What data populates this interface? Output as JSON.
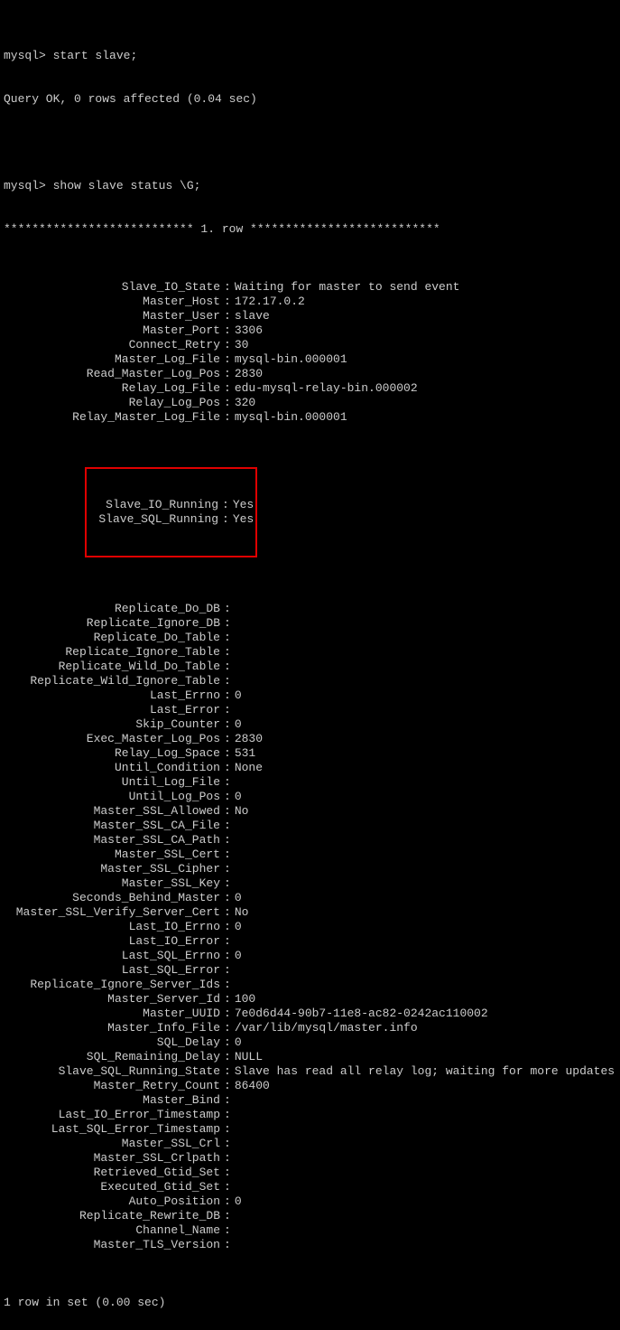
{
  "prompt": "mysql>",
  "cmd1": "start slave;",
  "result1": "Query OK, 0 rows affected (0.04 sec)",
  "cmd2": "show slave status \\G;",
  "row_header": "*************************** 1. row ***************************",
  "fields": [
    {
      "k": "Slave_IO_State",
      "v": "Waiting for master to send event"
    },
    {
      "k": "Master_Host",
      "v": "172.17.0.2"
    },
    {
      "k": "Master_User",
      "v": "slave"
    },
    {
      "k": "Master_Port",
      "v": "3306"
    },
    {
      "k": "Connect_Retry",
      "v": "30"
    },
    {
      "k": "Master_Log_File",
      "v": "mysql-bin.000001"
    },
    {
      "k": "Read_Master_Log_Pos",
      "v": "2830"
    },
    {
      "k": "Relay_Log_File",
      "v": "edu-mysql-relay-bin.000002"
    },
    {
      "k": "Relay_Log_Pos",
      "v": "320"
    },
    {
      "k": "Relay_Master_Log_File",
      "v": "mysql-bin.000001"
    }
  ],
  "highlighted": [
    {
      "k": "Slave_IO_Running",
      "v": "Yes"
    },
    {
      "k": "Slave_SQL_Running",
      "v": "Yes"
    }
  ],
  "fields2": [
    {
      "k": "Replicate_Do_DB",
      "v": ""
    },
    {
      "k": "Replicate_Ignore_DB",
      "v": ""
    },
    {
      "k": "Replicate_Do_Table",
      "v": ""
    },
    {
      "k": "Replicate_Ignore_Table",
      "v": ""
    },
    {
      "k": "Replicate_Wild_Do_Table",
      "v": ""
    },
    {
      "k": "Replicate_Wild_Ignore_Table",
      "v": ""
    },
    {
      "k": "Last_Errno",
      "v": "0"
    },
    {
      "k": "Last_Error",
      "v": ""
    },
    {
      "k": "Skip_Counter",
      "v": "0"
    },
    {
      "k": "Exec_Master_Log_Pos",
      "v": "2830"
    },
    {
      "k": "Relay_Log_Space",
      "v": "531"
    },
    {
      "k": "Until_Condition",
      "v": "None"
    },
    {
      "k": "Until_Log_File",
      "v": ""
    },
    {
      "k": "Until_Log_Pos",
      "v": "0"
    },
    {
      "k": "Master_SSL_Allowed",
      "v": "No"
    },
    {
      "k": "Master_SSL_CA_File",
      "v": ""
    },
    {
      "k": "Master_SSL_CA_Path",
      "v": ""
    },
    {
      "k": "Master_SSL_Cert",
      "v": ""
    },
    {
      "k": "Master_SSL_Cipher",
      "v": ""
    },
    {
      "k": "Master_SSL_Key",
      "v": ""
    },
    {
      "k": "Seconds_Behind_Master",
      "v": "0"
    },
    {
      "k": "Master_SSL_Verify_Server_Cert",
      "v": "No"
    },
    {
      "k": "Last_IO_Errno",
      "v": "0"
    },
    {
      "k": "Last_IO_Error",
      "v": ""
    },
    {
      "k": "Last_SQL_Errno",
      "v": "0"
    },
    {
      "k": "Last_SQL_Error",
      "v": ""
    },
    {
      "k": "Replicate_Ignore_Server_Ids",
      "v": ""
    },
    {
      "k": "Master_Server_Id",
      "v": "100"
    },
    {
      "k": "Master_UUID",
      "v": "7e0d6d44-90b7-11e8-ac82-0242ac110002"
    },
    {
      "k": "Master_Info_File",
      "v": "/var/lib/mysql/master.info"
    },
    {
      "k": "SQL_Delay",
      "v": "0"
    },
    {
      "k": "SQL_Remaining_Delay",
      "v": "NULL"
    },
    {
      "k": "Slave_SQL_Running_State",
      "v": "Slave has read all relay log; waiting for more updates"
    },
    {
      "k": "Master_Retry_Count",
      "v": "86400"
    },
    {
      "k": "Master_Bind",
      "v": ""
    },
    {
      "k": "Last_IO_Error_Timestamp",
      "v": ""
    },
    {
      "k": "Last_SQL_Error_Timestamp",
      "v": ""
    },
    {
      "k": "Master_SSL_Crl",
      "v": ""
    },
    {
      "k": "Master_SSL_Crlpath",
      "v": ""
    },
    {
      "k": "Retrieved_Gtid_Set",
      "v": ""
    },
    {
      "k": "Executed_Gtid_Set",
      "v": ""
    },
    {
      "k": "Auto_Position",
      "v": "0"
    },
    {
      "k": "Replicate_Rewrite_DB",
      "v": ""
    },
    {
      "k": "Channel_Name",
      "v": ""
    },
    {
      "k": "Master_TLS_Version",
      "v": ""
    }
  ],
  "footer": "1 row in set (0.00 sec)"
}
